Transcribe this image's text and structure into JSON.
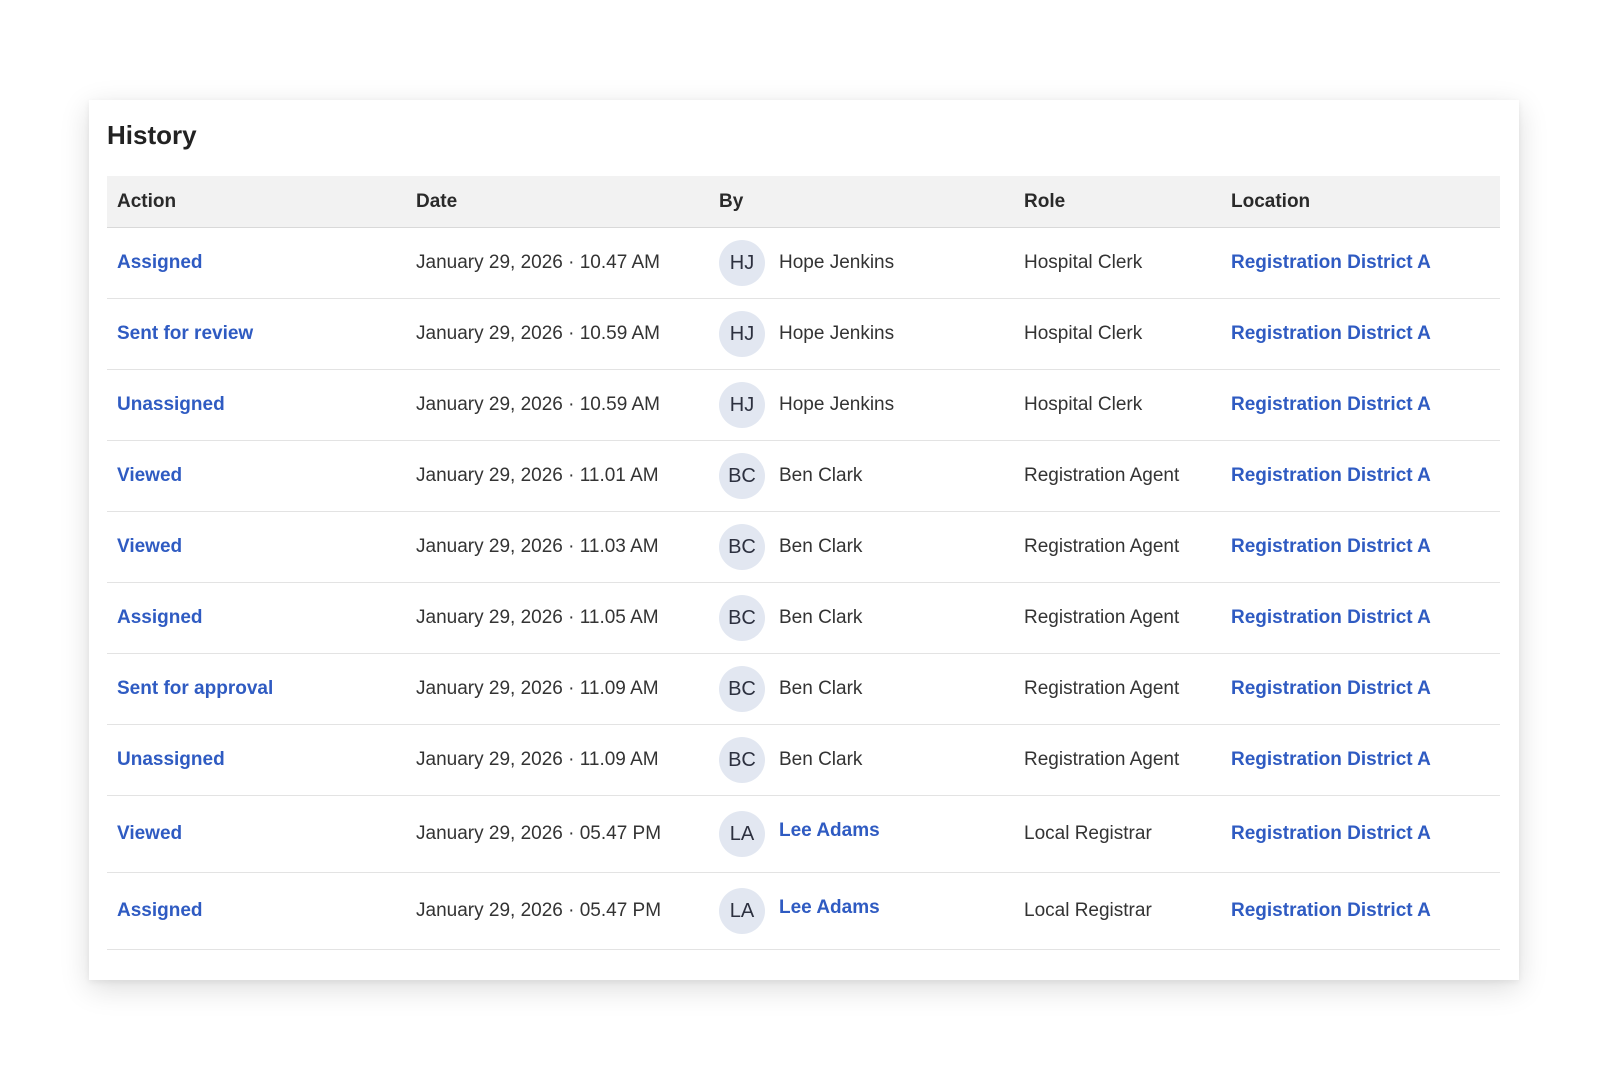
{
  "history": {
    "title": "History",
    "columns": [
      "Action",
      "Date",
      "By",
      "Role",
      "Location"
    ],
    "rows": [
      {
        "action": "Assigned",
        "date": "January 29, 2026 · 10.47 AM",
        "initials": "HJ",
        "name": "Hope Jenkins",
        "name_is_link": false,
        "role": "Hospital Clerk",
        "location": "Registration District A"
      },
      {
        "action": "Sent for review",
        "date": "January 29, 2026 · 10.59 AM",
        "initials": "HJ",
        "name": "Hope Jenkins",
        "name_is_link": false,
        "role": "Hospital Clerk",
        "location": "Registration District A"
      },
      {
        "action": "Unassigned",
        "date": "January 29, 2026 · 10.59 AM",
        "initials": "HJ",
        "name": "Hope Jenkins",
        "name_is_link": false,
        "role": "Hospital Clerk",
        "location": "Registration District A"
      },
      {
        "action": "Viewed",
        "date": "January 29, 2026 · 11.01 AM",
        "initials": "BC",
        "name": "Ben Clark",
        "name_is_link": false,
        "role": "Registration Agent",
        "location": "Registration District A"
      },
      {
        "action": "Viewed",
        "date": "January 29, 2026 · 11.03 AM",
        "initials": "BC",
        "name": "Ben Clark",
        "name_is_link": false,
        "role": "Registration Agent",
        "location": "Registration District A"
      },
      {
        "action": "Assigned",
        "date": "January 29, 2026 · 11.05 AM",
        "initials": "BC",
        "name": "Ben Clark",
        "name_is_link": false,
        "role": "Registration Agent",
        "location": "Registration District A"
      },
      {
        "action": "Sent for approval",
        "date": "January 29, 2026 · 11.09 AM",
        "initials": "BC",
        "name": "Ben Clark",
        "name_is_link": false,
        "role": "Registration Agent",
        "location": "Registration District A"
      },
      {
        "action": "Unassigned",
        "date": "January 29, 2026 · 11.09 AM",
        "initials": "BC",
        "name": "Ben Clark",
        "name_is_link": false,
        "role": "Registration Agent",
        "location": "Registration District A"
      },
      {
        "action": "Viewed",
        "date": "January 29, 2026 · 05.47 PM",
        "initials": "LA",
        "name": "Lee Adams",
        "name_is_link": true,
        "role": "Local Registrar",
        "location": "Registration District A"
      },
      {
        "action": "Assigned",
        "date": "January 29, 2026 · 05.47 PM",
        "initials": "LA",
        "name": "Lee Adams",
        "name_is_link": true,
        "role": "Local Registrar",
        "location": "Registration District A"
      }
    ]
  },
  "colors": {
    "link": "#2f5bc2",
    "header_bg": "#f2f2f2",
    "avatar_bg": "#e2e7f1"
  }
}
